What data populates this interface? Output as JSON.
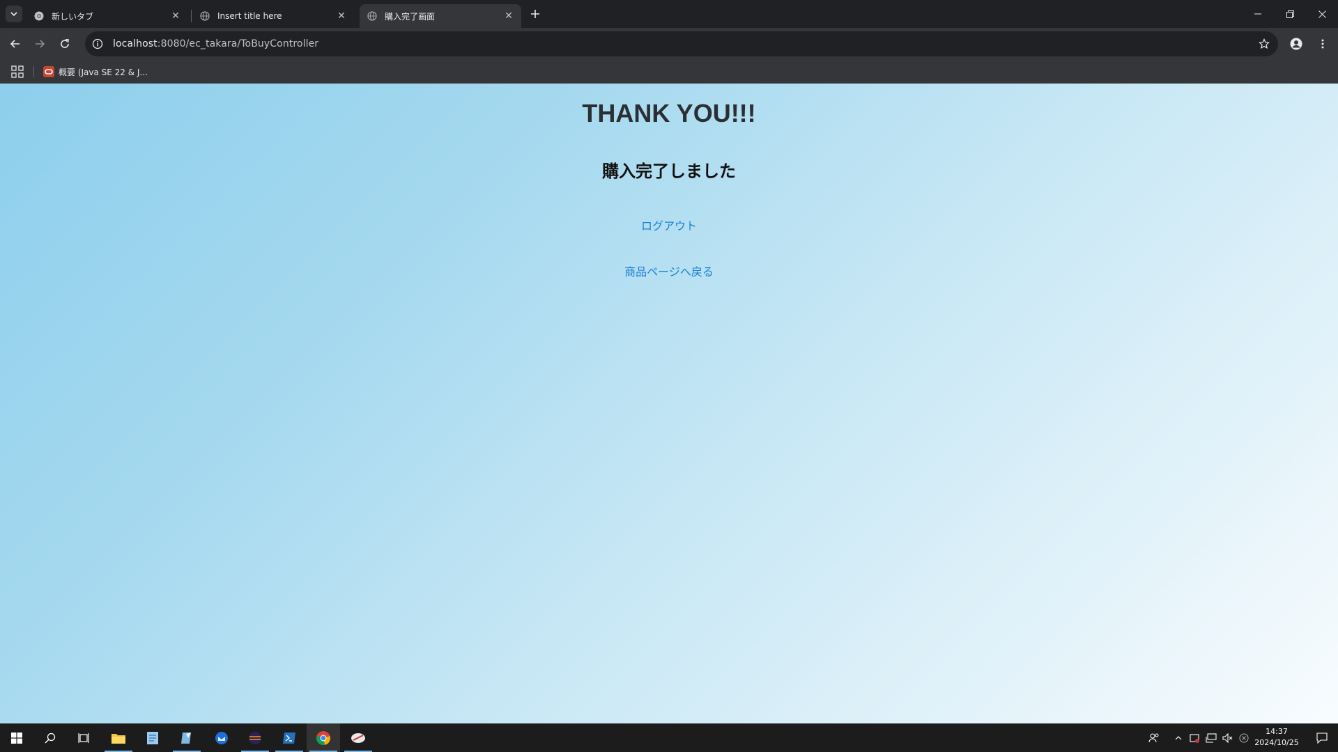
{
  "browser": {
    "tabs": [
      {
        "label": "新しいタブ",
        "active": false
      },
      {
        "label": "Insert title here",
        "active": false
      },
      {
        "label": "購入完了画面",
        "active": true
      }
    ],
    "url_host": "localhost",
    "url_rest": ":8080/ec_takara/ToBuyController",
    "bookmarks": [
      {
        "label": "概要 (Java SE 22 & J..."
      }
    ]
  },
  "page": {
    "heading": "THANK YOU!!!",
    "subheading": "購入完了しました",
    "logout_link": "ログアウト",
    "back_link": "商品ページへ戻る"
  },
  "taskbar": {
    "time": "14:37",
    "date": "2024/10/25"
  },
  "colors": {
    "link": "#1a7fd4",
    "page_gradient_start": "#8dcfec",
    "page_gradient_end": "#f8fcfe"
  }
}
